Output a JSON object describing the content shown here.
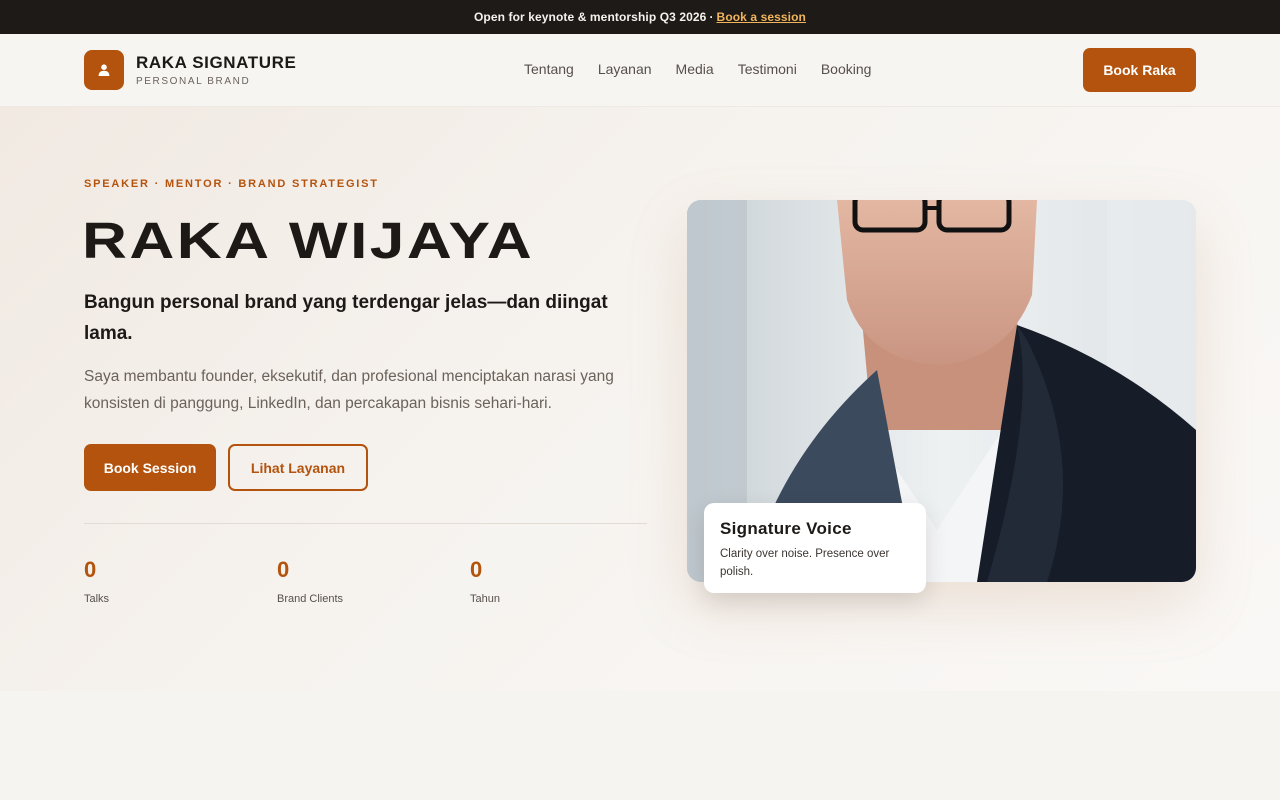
{
  "announcement": {
    "text": "Open for keynote & mentorship Q3 2026",
    "separator": "·",
    "link_label": "Book a session"
  },
  "header": {
    "brand_icon": "user-icon",
    "brand_name": "RAKA SIGNATURE",
    "brand_sub": "PERSONAL BRAND",
    "nav": [
      {
        "label": "Tentang"
      },
      {
        "label": "Layanan"
      },
      {
        "label": "Media"
      },
      {
        "label": "Testimoni"
      },
      {
        "label": "Booking"
      }
    ],
    "cta_label": "Book Raka"
  },
  "hero": {
    "eyebrow": "SPEAKER · MENTOR · BRAND STRATEGIST",
    "title": "RAKA WIJAYA",
    "tagline": "Bangun personal brand yang terdengar jelas—dan diingat lama.",
    "description": "Saya membantu founder, eksekutif, dan profesional menciptakan narasi yang konsisten di panggung, LinkedIn, dan percakapan bisnis sehari-hari.",
    "primary_cta": "Book Session",
    "secondary_cta": "Lihat Layanan",
    "stats": [
      {
        "value": "0",
        "label": "Talks"
      },
      {
        "value": "0",
        "label": "Brand Clients"
      },
      {
        "value": "0",
        "label": "Tahun"
      }
    ]
  },
  "signature_card": {
    "title": "Signature Voice",
    "text": "Clarity over noise. Presence over polish."
  },
  "colors": {
    "accent": "#b4530d",
    "topbar_bg": "#1e1a17",
    "link": "#f0b45c",
    "text_dark": "#1c1917"
  }
}
